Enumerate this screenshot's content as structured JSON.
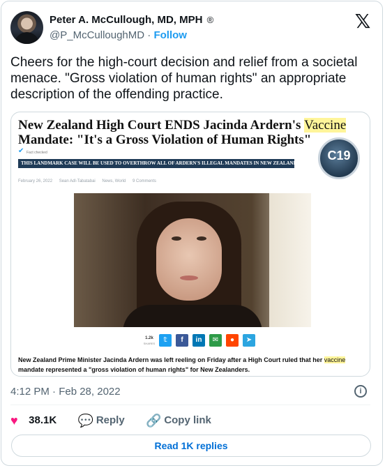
{
  "author": {
    "name": "Peter A. McCullough, MD, MPH",
    "badge": "®",
    "handle": "@P_McCulloughMD",
    "separator": "·",
    "follow_label": "Follow"
  },
  "tweet": {
    "text": "Cheers for the high-court decision and relief from a societal menace.  \"Gross violation of human rights\" an appropriate description of the offending practice."
  },
  "article": {
    "title_before": "New Zealand High Court ENDS Jacinda Ardern's ",
    "title_highlight": "Vaccine",
    "title_after": " Mandate: \"It's a Gross Violation of Human Rights\"",
    "fact_checked": "Fact checked",
    "banner": "THIS LANDMARK CASE WILL BE USED TO OVERTHROW ALL OF ARDERN'S ILLEGAL MANDATES IN NEW ZEALAND.",
    "logo_text": "C19",
    "byline": {
      "date": "February 26, 2022",
      "author": "Sean Adl-Tabatabai",
      "category": "News, World",
      "comments": "9 Comments"
    },
    "shares": {
      "count": "1.2k",
      "label": "SHARES"
    },
    "caption_before": "New Zealand Prime Minister Jacinda Ardern was left reeling on Friday after a High Court ruled that her ",
    "caption_highlight": "vaccine",
    "caption_after": " mandate represented a \"gross violation of human rights\" for New Zealanders."
  },
  "meta": {
    "timestamp": "4:12 PM · Feb 28, 2022"
  },
  "actions": {
    "likes": "38.1K",
    "reply_label": "Reply",
    "copy_label": "Copy link"
  },
  "read_replies_label": "Read 1K replies",
  "colors": {
    "accent": "#1d9bf0",
    "like": "#f91880",
    "banner": "#1f3b57"
  },
  "icons": [
    "x-logo",
    "verified-icon",
    "info-icon",
    "heart-icon",
    "reply-bubble-icon",
    "link-icon",
    "twitter-share-icon",
    "facebook-share-icon",
    "linkedin-share-icon",
    "email-share-icon",
    "reddit-share-icon",
    "telegram-share-icon"
  ]
}
